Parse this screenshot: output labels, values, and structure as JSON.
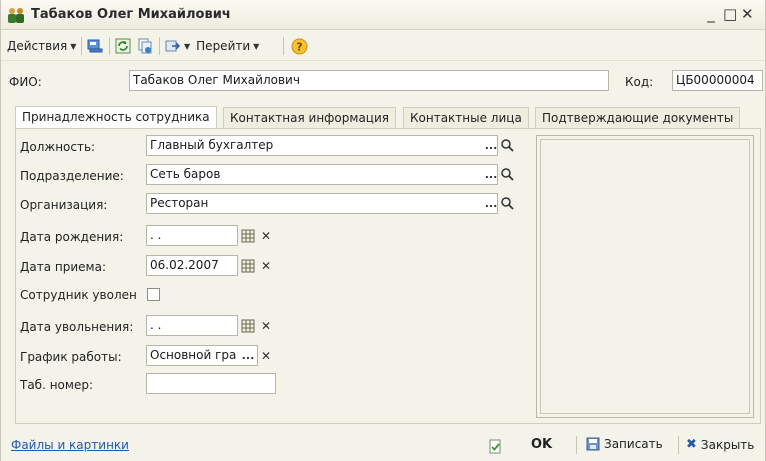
{
  "window": {
    "title": "Табаков Олег Михайлович",
    "controls": {
      "minimize": "_",
      "maximize": "□",
      "close": "✕"
    }
  },
  "toolbar": {
    "actions_label": "Действия",
    "goto_label": "Перейти",
    "icons": [
      "save-post-icon",
      "refresh-icon",
      "copy-doc-icon",
      "goto-icon",
      "help-icon"
    ]
  },
  "header": {
    "fio_label": "ФИО:",
    "fio_value": "Табаков Олег Михайлович",
    "code_label": "Код:",
    "code_value": "ЦБ00000004"
  },
  "tabs": [
    {
      "label": "Принадлежность сотрудника",
      "active": true
    },
    {
      "label": "Контактная информация",
      "active": false
    },
    {
      "label": "Контактные лица",
      "active": false
    },
    {
      "label": "Подтверждающие документы",
      "active": false
    }
  ],
  "form": {
    "position_label": "Должность:",
    "position_value": "Главный бухгалтер",
    "department_label": "Подразделение:",
    "department_value": "Сеть баров",
    "organization_label": "Организация:",
    "organization_value": "Ресторан",
    "birth_label": "Дата рождения:",
    "birth_value": " .  .",
    "hire_label": "Дата приема:",
    "hire_value": "06.02.2007",
    "fired_label": "Сотрудник уволен",
    "fired_checked": false,
    "dismissal_label": "Дата увольнения:",
    "dismissal_value": " .  .",
    "schedule_label": "График работы:",
    "schedule_value": "Основной гра",
    "tab_number_label": "Таб. номер:",
    "tab_number_value": "",
    "select_button": "...",
    "clear_button": "✕"
  },
  "footer": {
    "files_link": "Файлы и картинки",
    "ok_label": "OK",
    "save_label": "Записать",
    "close_label": "Закрыть"
  },
  "colors": {
    "background": "#f4f3ea",
    "link": "#2356b3",
    "border": "#b8b6a6"
  }
}
